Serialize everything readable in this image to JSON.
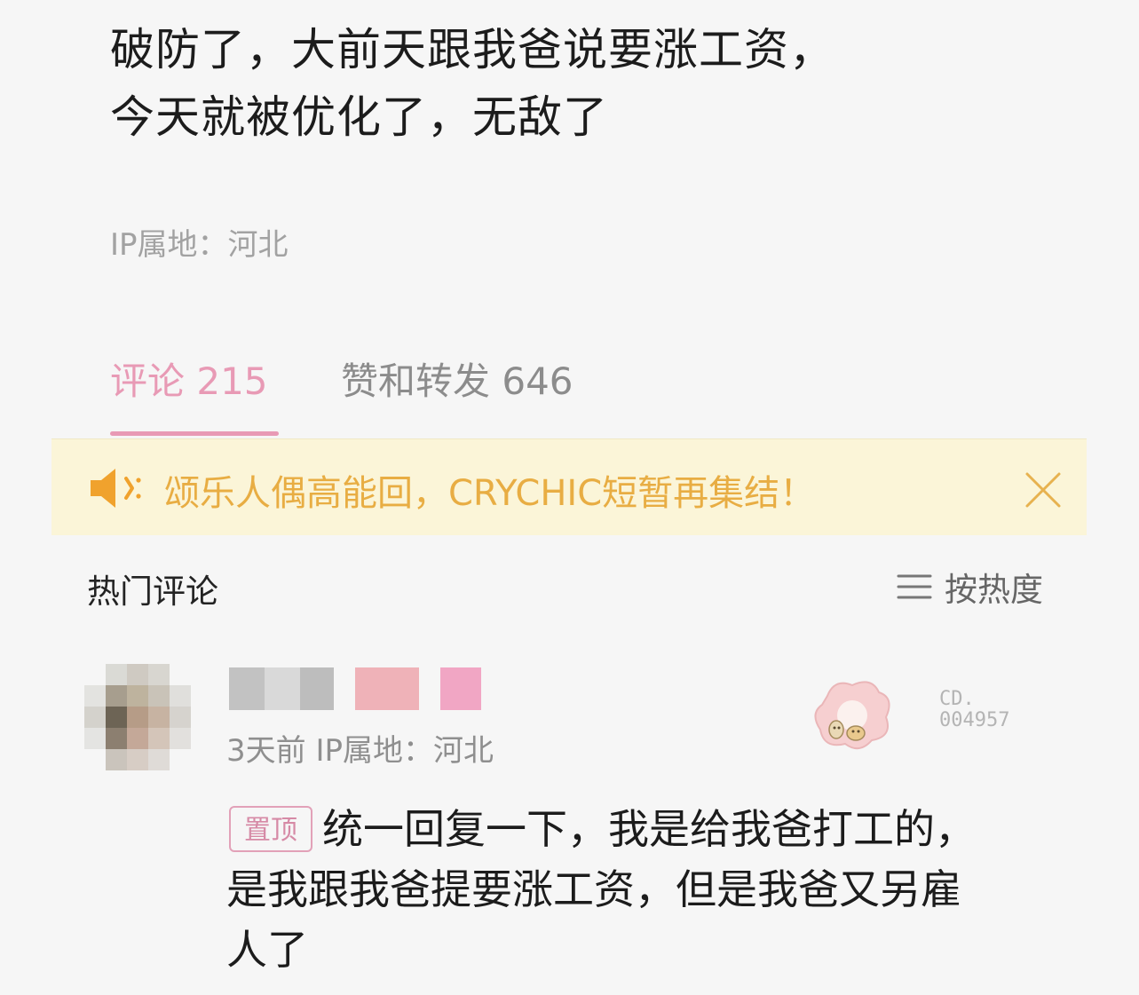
{
  "post": {
    "lines": [
      "破防了，大前天跟我爸说要涨工资，",
      "今天就被优化了，无敌了"
    ],
    "ip_location": "IP属地：河北"
  },
  "tabs": [
    {
      "label": "评论 215",
      "active": true
    },
    {
      "label": "赞和转发 646",
      "active": false
    }
  ],
  "notice": {
    "icon": "speaker-icon",
    "text": "颂乐人偶高能回，CRYCHIC短暂再集结！",
    "close_icon": "close-icon"
  },
  "comments_section": {
    "title": "热门评论",
    "sort_icon": "list-icon",
    "sort_label": "按热度"
  },
  "comment": {
    "meta": "3天前 IP属地：河北",
    "badge_code_lines": [
      "CD.",
      "004957"
    ],
    "pinned_label": "置顶",
    "body_lines": [
      "统一回复一下，我是给我爸打工的，",
      "是我跟我爸提要涨工资，但是我爸又另雇",
      "人了"
    ]
  },
  "colors": {
    "accent_pink": "#e89ab5",
    "notice_bg": "#fbf5d8",
    "notice_text": "#e8ad43"
  }
}
